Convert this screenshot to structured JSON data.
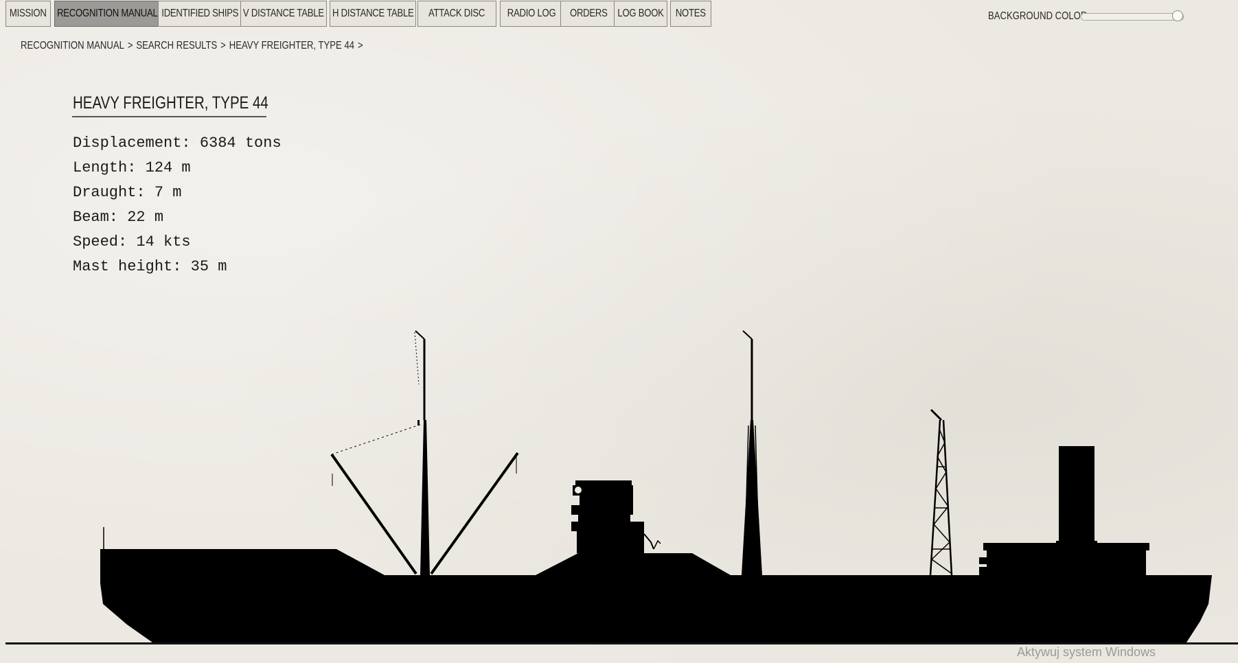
{
  "tabs": [
    {
      "label": "MISSION",
      "active": false
    },
    {
      "label": "RECOGNITION MANUAL",
      "active": true
    },
    {
      "label": "IDENTIFIED SHIPS",
      "active": false
    },
    {
      "label": "V DISTANCE TABLE",
      "active": false
    },
    {
      "label": "H DISTANCE TABLE",
      "active": false
    },
    {
      "label": "ATTACK DISC",
      "active": false
    },
    {
      "label": "RADIO LOG",
      "active": false
    },
    {
      "label": "ORDERS",
      "active": false
    },
    {
      "label": "LOG BOOK",
      "active": false
    },
    {
      "label": "NOTES",
      "active": false
    }
  ],
  "background_color": {
    "label": "BACKGROUND COLOR",
    "value": 1.0
  },
  "breadcrumb": {
    "items": [
      "RECOGNITION MANUAL",
      "SEARCH RESULTS",
      "HEAVY FREIGHTER, TYPE 44"
    ],
    "separator": ">"
  },
  "ship": {
    "title": "HEAVY FREIGHTER, TYPE 44",
    "specs": [
      "Displacement: 6384 tons",
      "Length: 124 m",
      "Draught: 7 m",
      "Beam: 22 m",
      "Speed: 14 kts",
      "Mast height: 35 m"
    ]
  },
  "watermark": "Aktywuj system Windows"
}
